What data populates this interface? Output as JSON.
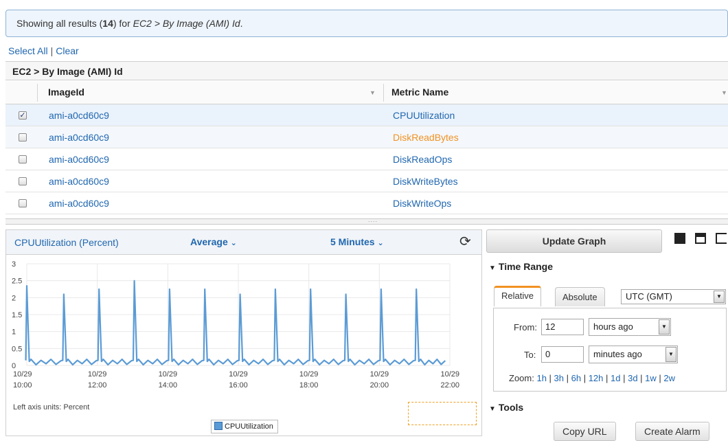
{
  "banner": {
    "prefix": "Showing all results (",
    "count": "14",
    "middle": ") for ",
    "path": "EC2 > By Image (AMI) Id",
    "suffix": "."
  },
  "selection": {
    "select_all": "Select All",
    "separator": "|",
    "clear": "Clear"
  },
  "group_title": "EC2 > By Image (AMI) Id",
  "columns": {
    "image_id": "ImageId",
    "metric_name": "Metric Name"
  },
  "rows": [
    {
      "image_id": "ami-a0cd60c9",
      "metric": "CPUUtilization",
      "checked": true
    },
    {
      "image_id": "ami-a0cd60c9",
      "metric": "DiskReadBytes",
      "checked": false
    },
    {
      "image_id": "ami-a0cd60c9",
      "metric": "DiskReadOps",
      "checked": false
    },
    {
      "image_id": "ami-a0cd60c9",
      "metric": "DiskWriteBytes",
      "checked": false
    },
    {
      "image_id": "ami-a0cd60c9",
      "metric": "DiskWriteOps",
      "checked": false
    }
  ],
  "graph": {
    "title": "CPUUtilization (Percent)",
    "statistic": "Average",
    "period": "5 Minutes",
    "left_axis_units": "Left axis units:  Percent",
    "legend": "CPUUtilization",
    "line_color": "#5b9bd5"
  },
  "chart_data": {
    "type": "line",
    "y_ticks": [
      "0",
      "0.5",
      "1",
      "1.5",
      "2",
      "2.5",
      "3"
    ],
    "ylim": [
      0,
      3
    ],
    "x_ticks": [
      {
        "date": "10/29",
        "time": "10:00"
      },
      {
        "date": "10/29",
        "time": "12:00"
      },
      {
        "date": "10/29",
        "time": "14:00"
      },
      {
        "date": "10/29",
        "time": "16:00"
      },
      {
        "date": "10/29",
        "time": "18:00"
      },
      {
        "date": "10/29",
        "time": "20:00"
      },
      {
        "date": "10/29",
        "time": "22:00"
      }
    ],
    "series": [
      {
        "name": "CPUUtilization",
        "spikes": [
          {
            "hour": 10.0,
            "value": 2.35
          },
          {
            "hour": 11.05,
            "value": 2.1
          },
          {
            "hour": 12.05,
            "value": 2.25
          },
          {
            "hour": 13.05,
            "value": 2.5
          },
          {
            "hour": 14.05,
            "value": 2.25
          },
          {
            "hour": 15.05,
            "value": 2.25
          },
          {
            "hour": 16.05,
            "value": 2.1
          },
          {
            "hour": 17.05,
            "value": 2.25
          },
          {
            "hour": 18.05,
            "value": 2.25
          },
          {
            "hour": 19.05,
            "value": 2.1
          },
          {
            "hour": 20.05,
            "value": 2.25
          },
          {
            "hour": 21.05,
            "value": 2.25
          }
        ],
        "baseline_range": [
          0.0,
          0.18
        ]
      }
    ],
    "grid": true,
    "legend_position": "bottom-center"
  },
  "update_button": "Update Graph",
  "time_range": {
    "header": "Time Range",
    "tab_relative": "Relative",
    "tab_absolute": "Absolute",
    "timezone": "UTC (GMT)",
    "from_label": "From:",
    "from_value": "12",
    "from_unit": "hours ago",
    "to_label": "To:",
    "to_value": "0",
    "to_unit": "minutes ago",
    "zoom_label": "Zoom:",
    "zoom_options": [
      "1h",
      "3h",
      "6h",
      "12h",
      "1d",
      "3d",
      "1w",
      "2w"
    ]
  },
  "tools": {
    "header": "Tools",
    "copy_url": "Copy URL",
    "create_alarm": "Create Alarm"
  }
}
